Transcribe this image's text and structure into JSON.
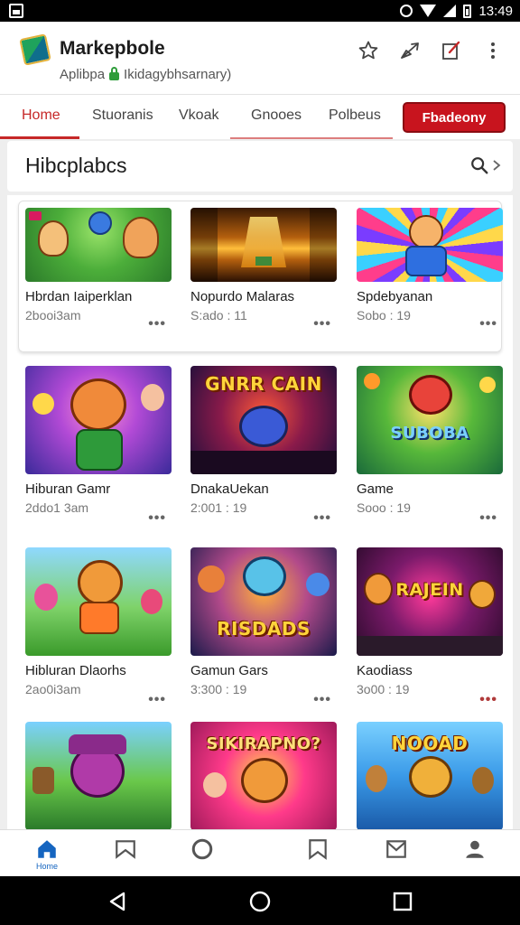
{
  "status_bar": {
    "time": "13:49",
    "icons": [
      "image-icon",
      "alarm-icon",
      "wifi-icon",
      "signal-icon",
      "battery-icon"
    ]
  },
  "header": {
    "app_name": "Markepbole",
    "subtitle_a": "Aplibpa",
    "subtitle_b": "Ikidagybhsarnary)",
    "actions": [
      "star-icon",
      "share-icon",
      "edit-icon",
      "more-vert-icon"
    ]
  },
  "tabs": [
    {
      "label": "Home",
      "active": true
    },
    {
      "label": "Stuoranis",
      "active": false
    },
    {
      "label": "Vkoak",
      "active": false
    },
    {
      "label": "Gnooes",
      "active": false
    },
    {
      "label": "Polbeus",
      "active": false
    }
  ],
  "cta_label": "Fbadeony",
  "section": {
    "title": "Hibcplabcs"
  },
  "games": [
    {
      "title": "Hbrdan Iaiperklan",
      "meta": "2booi3am",
      "theme": "cartoon-friends"
    },
    {
      "title": "Nopurdo Malaras",
      "meta": "S:ado : 11",
      "theme": "golden-corridor"
    },
    {
      "title": "Spdebyanan",
      "meta": "Sobo : 19",
      "theme": "hero-burst"
    },
    {
      "title": "Hiburan Gamr",
      "meta": "2ddo1 3am",
      "theme": "bear-hero"
    },
    {
      "title": "DnakaUekan",
      "meta": "2:001 : 19",
      "theme": "robot-arena",
      "caption": "GNRR CAIN"
    },
    {
      "title": "Game",
      "meta": "Sooo : 19",
      "theme": "monster-party",
      "caption": "SUBOBA"
    },
    {
      "title": "Hibluran Dlaorhs",
      "meta": "2ao0i3am",
      "theme": "runner-field"
    },
    {
      "title": "Gamun Gars",
      "meta": "3:300 : 19",
      "theme": "cat-heroes",
      "caption": "RISDADS"
    },
    {
      "title": "Kaodiass",
      "meta": "3o00 : 19",
      "theme": "jungle-tiger",
      "caption": "RAJEIN"
    },
    {
      "title": "",
      "meta": "",
      "theme": "purple-creature"
    },
    {
      "title": "",
      "meta": "",
      "theme": "colorful-bear",
      "caption": "SIKIRAPNO?"
    },
    {
      "title": "",
      "meta": "",
      "theme": "treasure-beach",
      "caption": "NOOAD"
    }
  ],
  "bottom_nav": [
    {
      "icon": "home-icon",
      "label": "Home",
      "active": true
    },
    {
      "icon": "bookmark-icon",
      "label": "",
      "active": false
    },
    {
      "icon": "circle-icon",
      "label": "",
      "active": false
    },
    {
      "icon": "bookmark-outline-icon",
      "label": "",
      "active": false
    },
    {
      "icon": "mail-icon",
      "label": "",
      "active": false
    },
    {
      "icon": "person-icon",
      "label": "",
      "active": false
    }
  ],
  "colors": {
    "accent": "#c62828",
    "cta": "#c8141e",
    "nav_active": "#1565c0"
  }
}
